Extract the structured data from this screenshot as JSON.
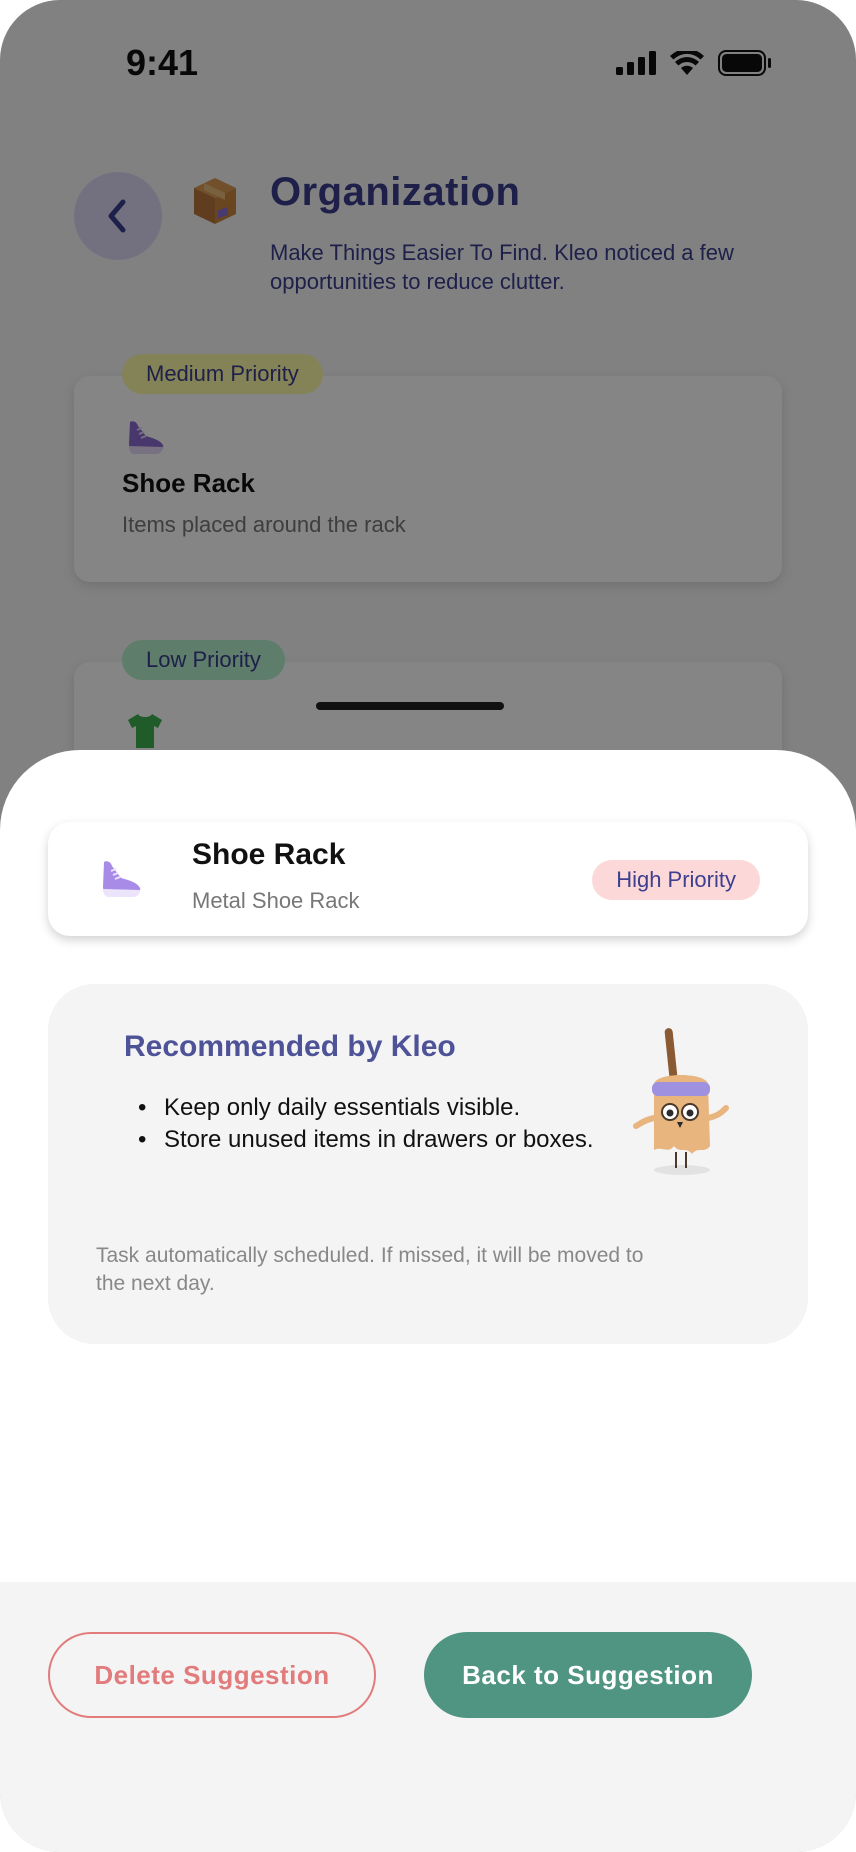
{
  "status_bar": {
    "time": "9:41"
  },
  "header": {
    "title": "Organization",
    "description": "Make Things Easier To Find. Kleo noticed a few opportunities to reduce clutter.",
    "back_icon": "chevron-left-icon",
    "category_icon": "package-box-icon"
  },
  "background_cards": [
    {
      "priority": "Medium Priority",
      "icon": "sneaker-icon",
      "title": "Shoe Rack",
      "subtitle": "Items placed around the rack",
      "priority_color": "#fbfba8"
    },
    {
      "priority": "Low Priority",
      "icon": "tshirt-icon",
      "priority_color": "#b5f0cd"
    }
  ],
  "sheet": {
    "item": {
      "icon": "sneaker-icon",
      "title": "Shoe Rack",
      "subtitle": "Metal Shoe Rack",
      "priority": "High Priority"
    },
    "recommendation": {
      "title": "Recommended by Kleo",
      "tips": [
        "Keep only daily essentials visible.",
        " Store unused items in drawers or boxes."
      ],
      "note": "Task automatically scheduled. If missed, it will be moved to the next day.",
      "mascot_icon": "broom-mascot-icon"
    },
    "buttons": {
      "delete_label": "Delete Suggestion",
      "back_label": "Back to Suggestion"
    }
  },
  "colors": {
    "accent": "#3d3f8f",
    "primary_button": "#509581",
    "danger": "#e27b7b",
    "high_priority": "#fdd8d8"
  }
}
